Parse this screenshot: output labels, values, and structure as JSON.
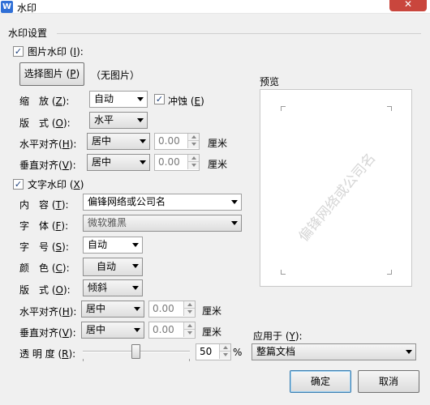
{
  "window": {
    "title": "水印",
    "app_icon": "W",
    "close_glyph": "✕"
  },
  "group": {
    "label": "水印设置"
  },
  "picture": {
    "checkbox_label": "图片水印",
    "checkbox_key": "I",
    "checked": true,
    "select_button": "选择图片",
    "select_key": "P",
    "status": "（无图片）",
    "scale": {
      "label": "缩　放",
      "key": "Z",
      "value": "自动"
    },
    "washout": {
      "label": "冲蚀",
      "key": "E",
      "checked": true
    },
    "layout": {
      "label": "版　式",
      "key": "O",
      "value": "水平"
    },
    "h_align": {
      "label": "水平对齐",
      "key": "H",
      "value": "居中",
      "offset": "0.00",
      "unit": "厘米"
    },
    "v_align": {
      "label": "垂直对齐",
      "key": "V",
      "value": "居中",
      "offset": "0.00",
      "unit": "厘米"
    }
  },
  "text": {
    "checkbox_label": "文字水印",
    "checkbox_key": "X",
    "checked": true,
    "content": {
      "label": "内　容",
      "key": "T",
      "value": "偏锋网络或公司名"
    },
    "font": {
      "label": "字　体",
      "key": "F",
      "value": "微软雅黑"
    },
    "size": {
      "label": "字　号",
      "key": "S",
      "value": "自动"
    },
    "color": {
      "label": "颜　色",
      "key": "C",
      "value": "自动"
    },
    "layout": {
      "label": "版　式",
      "key": "O",
      "value": "倾斜"
    },
    "h_align": {
      "label": "水平对齐",
      "key": "H",
      "value": "居中",
      "offset": "0.00",
      "unit": "厘米"
    },
    "v_align": {
      "label": "垂直对齐",
      "key": "V",
      "value": "居中",
      "offset": "0.00",
      "unit": "厘米"
    },
    "transparency": {
      "label": "透 明 度",
      "key": "R",
      "value": "50",
      "unit": "%",
      "level_percent": 50
    }
  },
  "preview": {
    "label": "预览",
    "watermark_text": "偏锋网络或公司名"
  },
  "apply": {
    "label": "应用于",
    "key": "Y",
    "value": "整篇文档"
  },
  "buttons": {
    "ok": "确定",
    "cancel": "取消"
  }
}
